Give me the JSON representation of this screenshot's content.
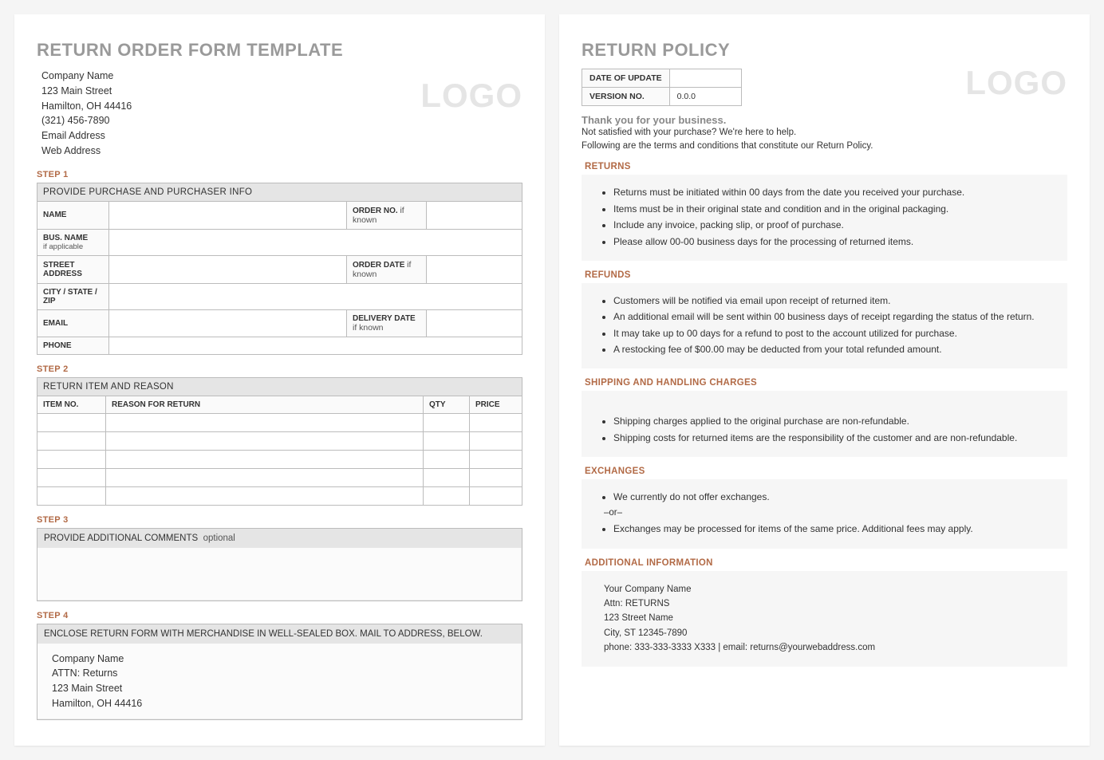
{
  "form": {
    "title": "RETURN ORDER FORM TEMPLATE",
    "logo": "LOGO",
    "company": {
      "name": "Company Name",
      "street": "123 Main Street",
      "city_line": "Hamilton, OH 44416",
      "phone": "(321) 456-7890",
      "email": "Email Address",
      "web": "Web Address"
    },
    "step1": {
      "label": "STEP 1",
      "header": "PROVIDE PURCHASE AND PURCHASER INFO",
      "rows": {
        "name": "NAME",
        "order_no": "ORDER NO.",
        "bus_name": "BUS. NAME",
        "bus_sub": "if applicable",
        "street": "STREET ADDRESS",
        "order_date": "ORDER DATE",
        "csz": "CITY / STATE / ZIP",
        "email": "EMAIL",
        "delivery_date": "DELIVERY DATE",
        "phone": "PHONE",
        "if_known": "if known"
      }
    },
    "step2": {
      "label": "STEP 2",
      "header": "RETURN ITEM AND REASON",
      "cols": {
        "c0": "ITEM NO.",
        "c1": "REASON FOR RETURN",
        "c2": "QTY",
        "c3": "PRICE"
      }
    },
    "step3": {
      "label": "STEP 3",
      "header": "PROVIDE ADDITIONAL COMMENTS",
      "opt": "optional"
    },
    "step4": {
      "label": "STEP 4",
      "header": "ENCLOSE RETURN FORM WITH MERCHANDISE IN WELL-SEALED BOX.  MAIL TO ADDRESS, BELOW.",
      "addr": {
        "l1": "Company Name",
        "l2": "ATTN: Returns",
        "l3": "123 Main Street",
        "l4": "Hamilton, OH 44416"
      }
    }
  },
  "policy": {
    "title": "RETURN POLICY",
    "logo": "LOGO",
    "meta": {
      "date_label": "DATE OF UPDATE",
      "date_val": "",
      "ver_label": "VERSION NO.",
      "ver_val": "0.0.0"
    },
    "thanks": "Thank you for your business.",
    "intro1": "Not satisfied with your purchase? We're here to help.",
    "intro2": "Following are the terms and conditions that constitute our Return Policy.",
    "returns": {
      "label": "RETURNS",
      "items": [
        "Returns must be initiated within 00 days from the date you received your purchase.",
        "Items must be in their original state and condition and in the original packaging.",
        "Include any invoice, packing slip, or proof of purchase.",
        "Please allow 00-00 business days for the processing of returned items."
      ]
    },
    "refunds": {
      "label": "REFUNDS",
      "items": [
        "Customers will be notified via email upon receipt of returned item.",
        "An additional email will be sent within 00 business days of receipt regarding the status of the return.",
        "It may take up to 00 days for a refund to post to the account utilized for purchase.",
        "A restocking fee of $00.00 may be deducted from your total refunded amount."
      ]
    },
    "shipping": {
      "label": "SHIPPING AND HANDLING CHARGES",
      "items": [
        "Shipping charges applied to the original purchase are non-refundable.",
        "Shipping costs for returned items are the responsibility of the customer and are non-refundable."
      ]
    },
    "exchanges": {
      "label": "EXCHANGES",
      "item1": "We currently do not offer exchanges.",
      "or": "–or–",
      "item2": "Exchanges may be processed for items of the same price. Additional fees may apply."
    },
    "addl": {
      "label": "ADDITIONAL INFORMATION",
      "l1": "Your Company Name",
      "l2": "Attn: RETURNS",
      "l3": "123 Street Name",
      "l4": "City, ST  12345-7890",
      "l5": "phone: 333-333-3333 X333    |    email: returns@yourwebaddress.com"
    }
  }
}
